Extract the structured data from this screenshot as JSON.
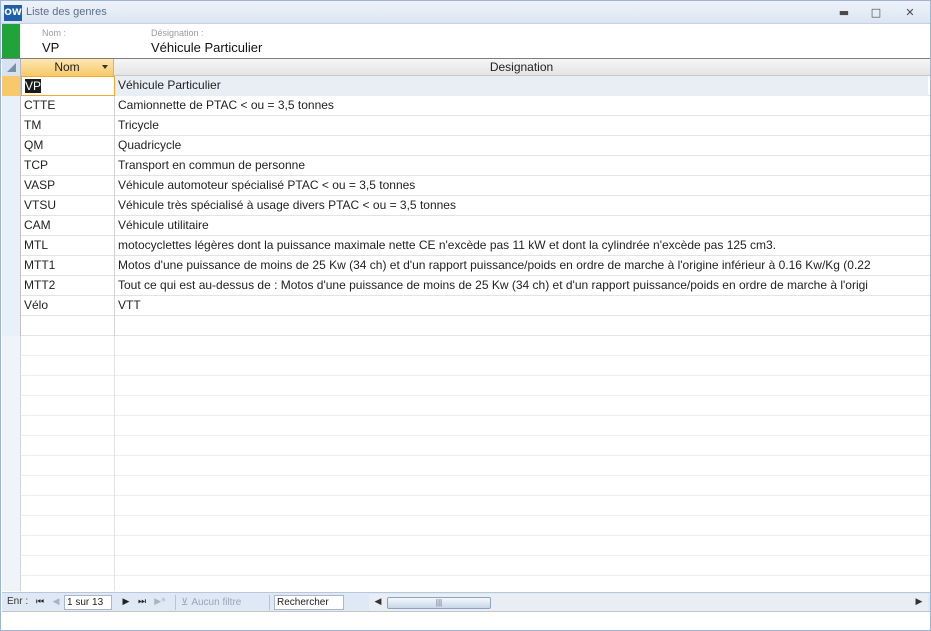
{
  "window": {
    "app_icon": "OW",
    "title": "Liste des genres",
    "controls": {
      "minimize": "▬",
      "maximize": "□",
      "close": "✕"
    }
  },
  "header": {
    "nom_label": "Nom :",
    "nom_value": "VP",
    "designation_label": "Désignation :",
    "designation_value": "Véhicule Particulier"
  },
  "grid": {
    "columns": [
      "Nom",
      "Designation"
    ],
    "rows": [
      {
        "nom": "VP",
        "designation": "Véhicule Particulier"
      },
      {
        "nom": "CTTE",
        "designation": "Camionnette de PTAC < ou = 3,5 tonnes"
      },
      {
        "nom": "TM",
        "designation": "Tricycle"
      },
      {
        "nom": "QM",
        "designation": "Quadricycle"
      },
      {
        "nom": "TCP",
        "designation": "Transport en commun de personne"
      },
      {
        "nom": "VASP",
        "designation": "Véhicule automoteur spécialisé PTAC < ou = 3,5 tonnes"
      },
      {
        "nom": "VTSU",
        "designation": "Véhicule très spécialisé à usage divers  PTAC < ou = 3,5 tonnes"
      },
      {
        "nom": "CAM",
        "designation": "Véhicule utilitaire"
      },
      {
        "nom": "MTL",
        "designation": "motocyclettes légères dont la puissance maximale nette CE n'excède pas 11 kW et dont la cylindrée n'excède pas 125 cm3."
      },
      {
        "nom": "MTT1",
        "designation": "Motos d'une puissance de moins de 25 Kw (34 ch) et d'un rapport puissance/poids en ordre de marche à l'origine inférieur à 0.16 Kw/Kg (0.22"
      },
      {
        "nom": "MTT2",
        "designation": "Tout ce qui est au-dessus de : Motos d'une puissance de moins de 25 Kw (34 ch) et d'un rapport puissance/poids en ordre de marche à l'origi"
      },
      {
        "nom": "Vélo",
        "designation": "VTT"
      },
      {
        "nom": "",
        "designation": ""
      }
    ],
    "empty_rows": 13
  },
  "navigation": {
    "label": "Enr :",
    "first": "⏮",
    "prev": "◀",
    "position": "1 sur 13",
    "next": "▶",
    "last": "⏭",
    "new": "▶*",
    "filter_icon": "funnel-icon",
    "filter_glyph": "⊻",
    "filter_label": "Aucun filtre",
    "search_label": "Rechercher",
    "scroll_left": "◀",
    "scroll_right": "▶",
    "scroll_grip": "|||"
  }
}
